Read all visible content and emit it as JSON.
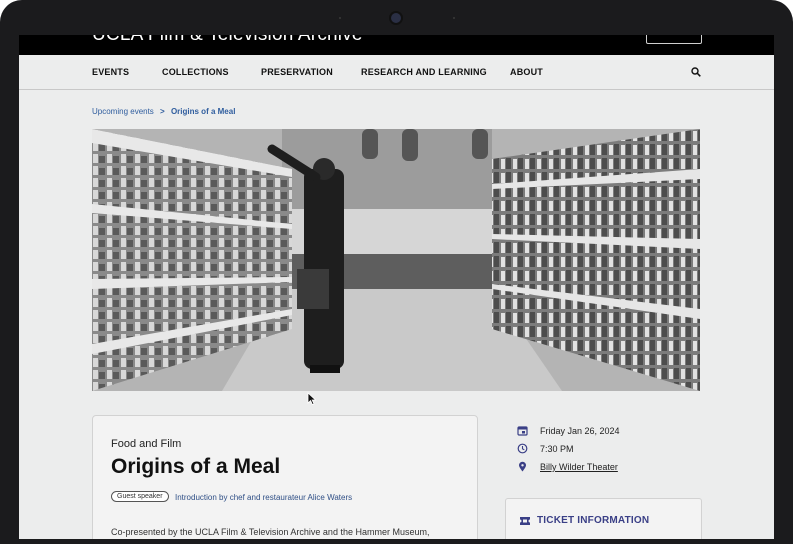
{
  "header": {
    "logo": "UCLA Film & Television Archive"
  },
  "nav": {
    "items": [
      {
        "label": "EVENTS"
      },
      {
        "label": "COLLECTIONS"
      },
      {
        "label": "PRESERVATION"
      },
      {
        "label": "RESEARCH AND LEARNING"
      },
      {
        "label": "ABOUT"
      }
    ],
    "search_icon": "search-icon"
  },
  "breadcrumb": {
    "parent": "Upcoming events",
    "separator": ">",
    "current": "Origins of a Meal"
  },
  "event": {
    "category": "Food and Film",
    "title": "Origins of a Meal",
    "tag": "Guest speaker",
    "intro": "Introduction by chef and restaurateur Alice Waters",
    "description": "Co-presented by the UCLA Film & Television Archive and the Hammer Museum,",
    "date": "Friday Jan 26, 2024",
    "time": "7:30 PM",
    "venue": "Billy Wilder Theater"
  },
  "ticket": {
    "title": "TICKET INFORMATION"
  },
  "colors": {
    "accent": "#3a3f86",
    "link": "#2f5d9e",
    "background": "#eceded"
  }
}
